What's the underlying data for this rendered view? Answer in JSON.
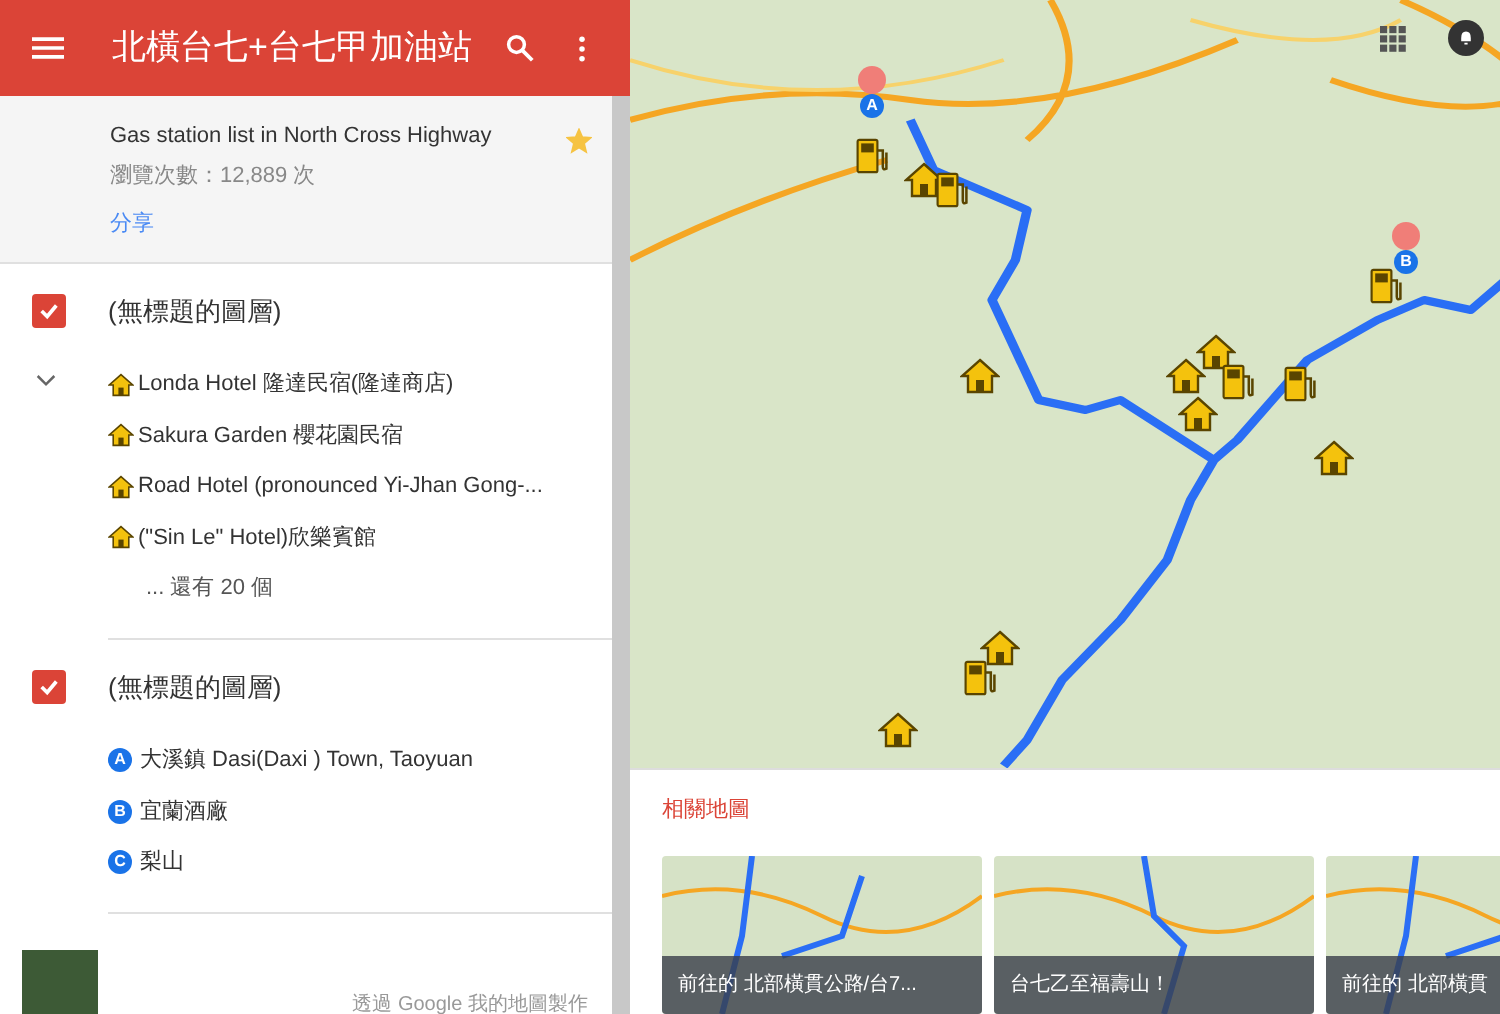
{
  "header": {
    "title": "北橫台七+台七甲加油站"
  },
  "map_info": {
    "description": "Gas station list in North Cross Highway",
    "views": "瀏覽次數：12,889 次",
    "share": "分享",
    "starred": true
  },
  "layers": [
    {
      "title": "(無標題的圖層)",
      "checked": true,
      "expanded": true,
      "items": [
        {
          "kind": "house",
          "name": "Londa Hotel 隆達民宿(隆達商店)"
        },
        {
          "kind": "house",
          "name": "Sakura Garden 櫻花園民宿"
        },
        {
          "kind": "house",
          "name": "Road Hotel (pronounced Yi-Jhan Gong-..."
        },
        {
          "kind": "house",
          "name": "(\"Sin Le\" Hotel)欣樂賓館"
        }
      ],
      "more": "... 還有 20 個"
    },
    {
      "title": "(無標題的圖層)",
      "checked": true,
      "items": [
        {
          "kind": "letter",
          "marker": "A",
          "name": "大溪鎮 Dasi(Daxi ) Town, Taoyuan"
        },
        {
          "kind": "letter",
          "marker": "B",
          "name": "宜蘭酒廠"
        },
        {
          "kind": "letter",
          "marker": "C",
          "name": "梨山"
        }
      ]
    }
  ],
  "footer": {
    "credit": "透過 Google 我的地圖製作"
  },
  "map": {
    "pins": [
      {
        "letter": "A"
      },
      {
        "letter": "B"
      }
    ]
  },
  "related": {
    "title": "相關地圖",
    "cards": [
      {
        "caption": "前往的 北部橫貫公路/台7..."
      },
      {
        "caption": "台七乙至福壽山！"
      },
      {
        "caption": "前往的 北部橫貫"
      }
    ]
  }
}
